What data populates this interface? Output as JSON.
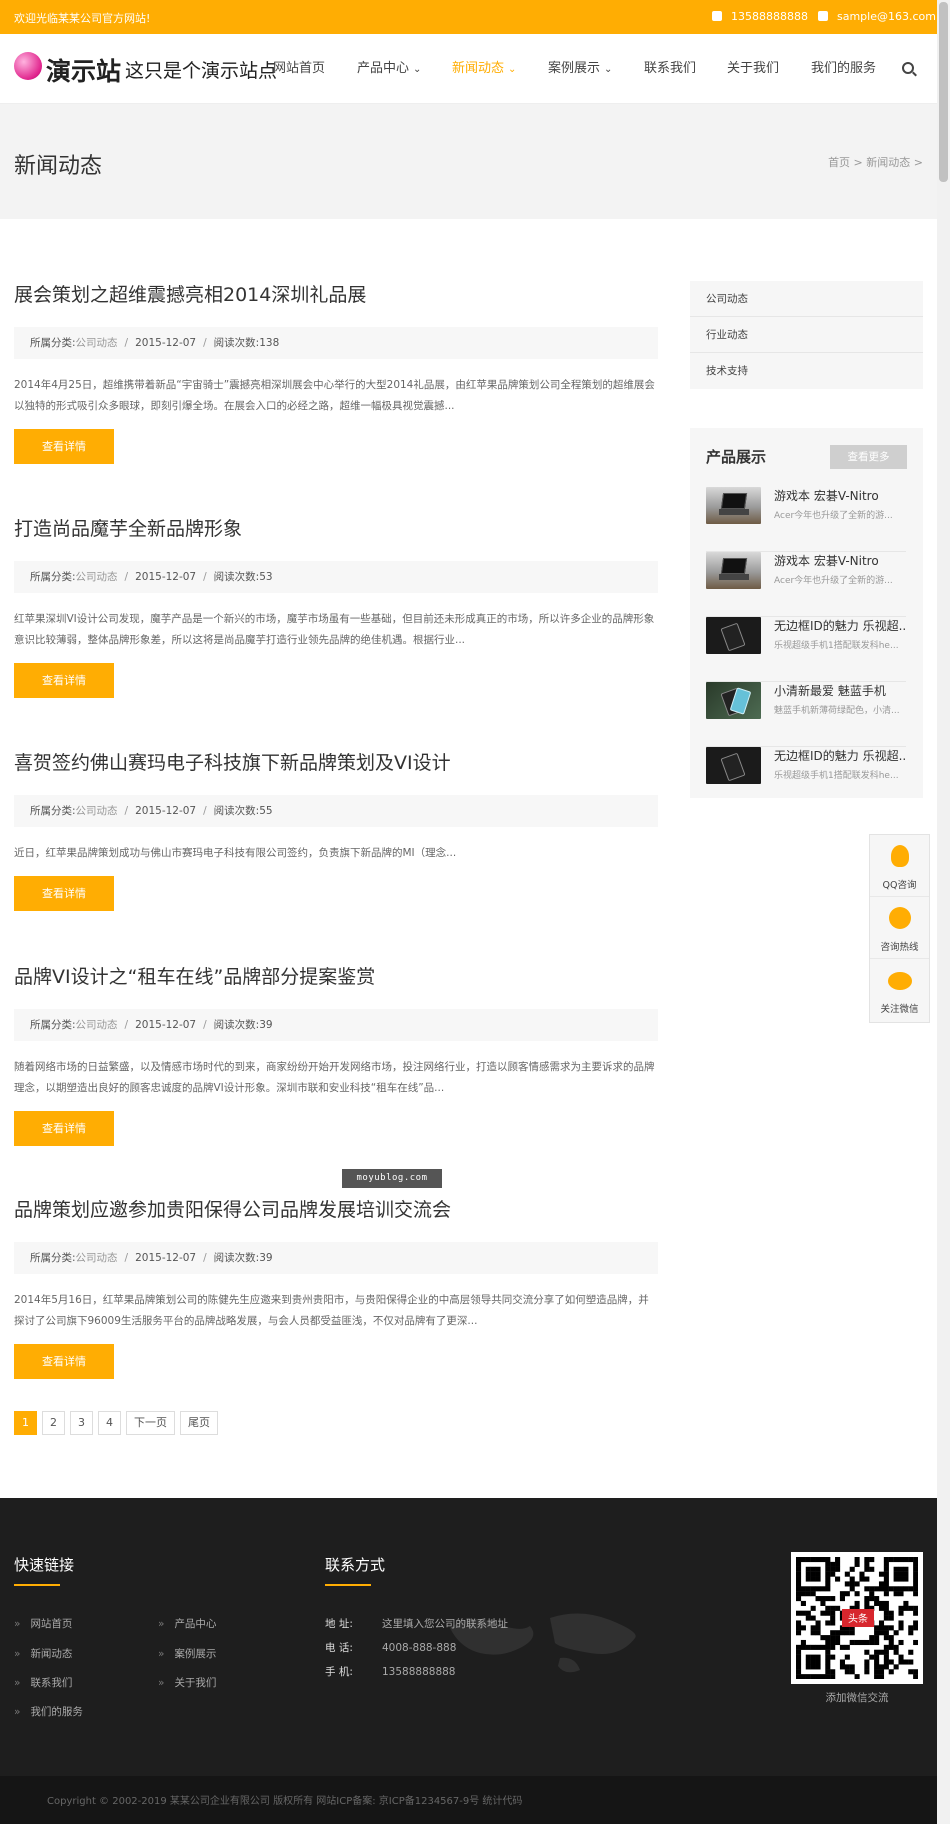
{
  "topbar": {
    "welcome": "欢迎光临某某公司官方网站!",
    "phone": "13588888888",
    "email": "sample@163.com"
  },
  "header": {
    "logo_text": "演示站",
    "logo_slogan": "这只是个演示站点",
    "nav": [
      {
        "label": "网站首页",
        "dropdown": false,
        "active": false
      },
      {
        "label": "产品中心",
        "dropdown": true,
        "active": false
      },
      {
        "label": "新闻动态",
        "dropdown": true,
        "active": true
      },
      {
        "label": "案例展示",
        "dropdown": true,
        "active": false
      },
      {
        "label": "联系我们",
        "dropdown": false,
        "active": false
      },
      {
        "label": "关于我们",
        "dropdown": false,
        "active": false
      },
      {
        "label": "我们的服务",
        "dropdown": false,
        "active": false
      }
    ],
    "chevron": "⌄"
  },
  "banner": {
    "title": "新闻动态",
    "breadcrumb": "首页 > 新闻动态 >"
  },
  "articles": [
    {
      "title": "展会策划之超维震撼亮相2014深圳礼品展",
      "category_label": "所属分类:",
      "category": "公司动态",
      "date": "2015-12-07",
      "reads_label": "阅读次数:",
      "reads": "138",
      "summary": "2014年4月25日，超维携带着新品“宇宙骑士”震撼亮相深圳展会中心举行的大型2014礼品展，由红苹果品牌策划公司全程策划的超维展会以独特的形式吸引众多眼球，即刻引爆全场。在展会入口的必经之路，超维一幅极具视觉震撼...",
      "button": "查看详情"
    },
    {
      "title": "打造尚品魔芋全新品牌形象",
      "category_label": "所属分类:",
      "category": "公司动态",
      "date": "2015-12-07",
      "reads_label": "阅读次数:",
      "reads": "53",
      "summary": "红苹果深圳VI设计公司发现，魔芋产品是一个新兴的市场，魔芋市场虽有一些基础，但目前还未形成真正的市场，所以许多企业的品牌形象意识比较薄弱，整体品牌形象差，所以这将是尚品魔芋打造行业领先品牌的绝佳机遇。根据行业...",
      "button": "查看详情"
    },
    {
      "title": "喜贺签约佛山赛玛电子科技旗下新品牌策划及VI设计",
      "category_label": "所属分类:",
      "category": "公司动态",
      "date": "2015-12-07",
      "reads_label": "阅读次数:",
      "reads": "55",
      "summary": "近日，红苹果品牌策划成功与佛山市赛玛电子科技有限公司签约，负责旗下新品牌的MI（理念...",
      "button": "查看详情"
    },
    {
      "title": "品牌VI设计之“租车在线”品牌部分提案鉴赏",
      "category_label": "所属分类:",
      "category": "公司动态",
      "date": "2015-12-07",
      "reads_label": "阅读次数:",
      "reads": "39",
      "summary": "随着网络市场的日益繁盛，以及情感市场时代的到来，商家纷纷开始开发网络市场，投注网络行业，打造以顾客情感需求为主要诉求的品牌理念，以期塑造出良好的顾客忠诚度的品牌VI设计形象。深圳市联和安业科技“租车在线”品...",
      "button": "查看详情"
    },
    {
      "title": "品牌策划应邀参加贵阳保得公司品牌发展培训交流会",
      "category_label": "所属分类:",
      "category": "公司动态",
      "date": "2015-12-07",
      "reads_label": "阅读次数:",
      "reads": "39",
      "summary": "2014年5月16日，红苹果品牌策划公司的陈健先生应邀来到贵州贵阳市，与贵阳保得企业的中高层领导共同交流分享了如何塑造品牌，并探讨了公司旗下96009生活服务平台的品牌战略发展，与会人员都受益匪浅，不仅对品牌有了更深...",
      "button": "查看详情"
    }
  ],
  "pagination": [
    "1",
    "2",
    "3",
    "4",
    "下一页",
    "尾页"
  ],
  "sidebar": {
    "categories": [
      "公司动态",
      "行业动态",
      "技术支持"
    ],
    "products_title": "产品展示",
    "products_more": "查看更多",
    "products": [
      {
        "name": "游戏本 宏碁V-Nitro",
        "desc": "Acer今年也升级了全新的游...",
        "thumb": "laptop"
      },
      {
        "name": "游戏本 宏碁V-Nitro",
        "desc": "Acer今年也升级了全新的游...",
        "thumb": "laptop"
      },
      {
        "name": "无边框ID的魅力 乐视超...",
        "desc": "乐视超级手机1搭配联发科he...",
        "thumb": "phone-dark"
      },
      {
        "name": "小清新最爱 魅蓝手机",
        "desc": "魅蓝手机新薄荷绿配色，小清...",
        "thumb": "phone-blue"
      },
      {
        "name": "无边框ID的魅力 乐视超...",
        "desc": "乐视超级手机1搭配联发科he...",
        "thumb": "phone-dark"
      }
    ]
  },
  "float_contact": [
    {
      "label": "QQ咨询",
      "icon": "qq-icon"
    },
    {
      "label": "咨询热线",
      "icon": "phone-icon"
    },
    {
      "label": "关注微信",
      "icon": "wechat-icon"
    }
  ],
  "watermark": "moyublog.com",
  "footer": {
    "links_title": "快速链接",
    "links": [
      "网站首页",
      "产品中心",
      "新闻动态",
      "案例展示",
      "联系我们",
      "关于我们",
      "我们的服务"
    ],
    "contact_title": "联系方式",
    "contact": [
      {
        "label": "地 址:",
        "value": "这里填入您公司的联系地址"
      },
      {
        "label": "电 话:",
        "value": "4008-888-888"
      },
      {
        "label": "手 机:",
        "value": "13588888888"
      }
    ],
    "qr_badge": "头条",
    "qr_caption": "添加微信交流",
    "copyright": "Copyright © 2002-2019 某某公司企业有限公司 版权所有    网站ICP备案: 京ICP备1234567-9号    统计代码"
  },
  "colors": {
    "accent": "#ffad03",
    "footer_bg": "#1e1e1e"
  }
}
